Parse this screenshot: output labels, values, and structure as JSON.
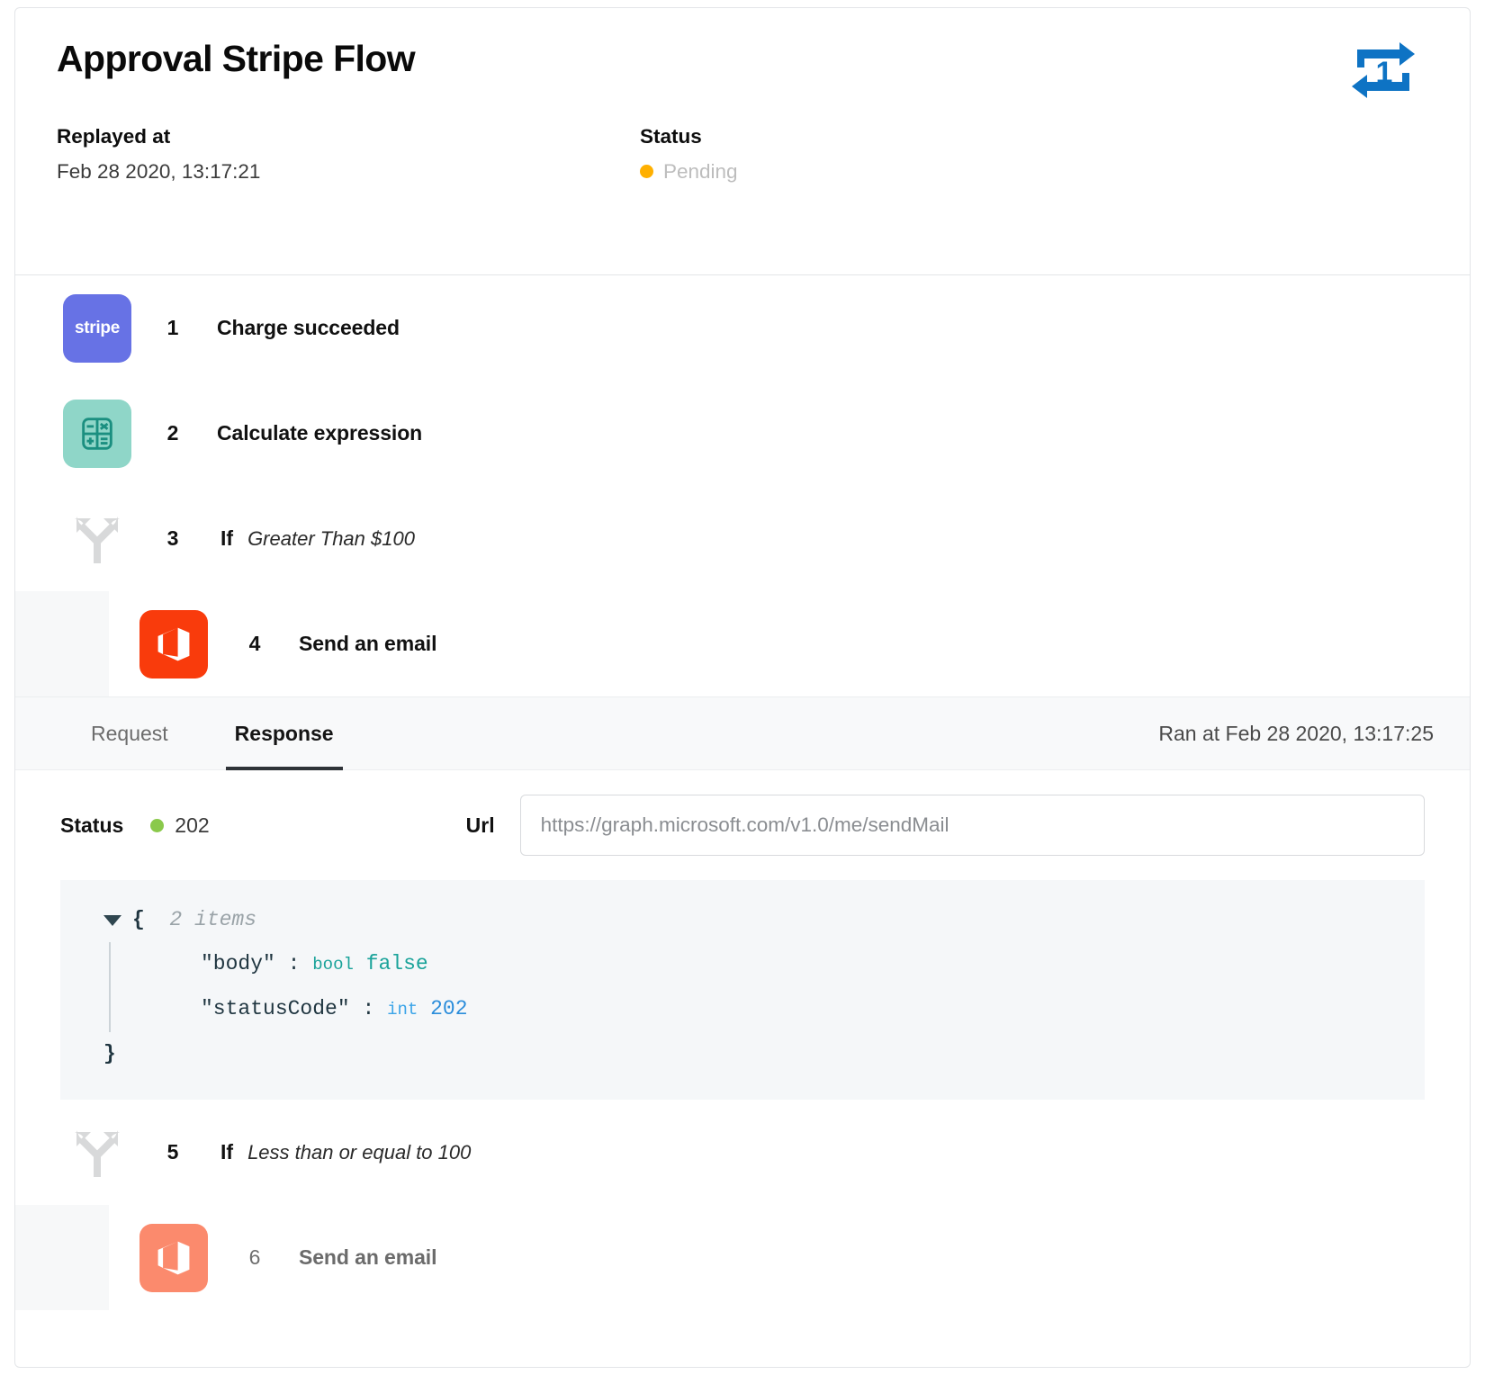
{
  "header": {
    "title": "Approval Stripe Flow",
    "replayed_label": "Replayed at",
    "replayed_value": "Feb 28 2020, 13:17:21",
    "status_label": "Status",
    "status_value": "Pending",
    "status_dot_color": "#ffb000",
    "replay_icon": "replay-once-icon",
    "replay_icon_color": "#0e73c4",
    "replay_icon_badge": "1"
  },
  "steps": [
    {
      "num": "1",
      "name": "Charge succeeded",
      "icon": "stripe-icon",
      "icon_label": "stripe",
      "icon_color": "#6772e5"
    },
    {
      "num": "2",
      "name": "Calculate expression",
      "icon": "calculator-icon",
      "icon_color": "#8fd6c8"
    },
    {
      "num": "3",
      "name": "If",
      "condition": "Greater Than $100",
      "icon": "branch-fork-icon",
      "icon_color": "#d8d9da"
    },
    {
      "num": "4",
      "name": "Send an email",
      "icon": "office365-icon",
      "icon_color": "#f93b0c"
    },
    {
      "num": "5",
      "name": "If",
      "condition": "Less than or equal to 100",
      "icon": "branch-fork-icon",
      "icon_color": "#d8d9da"
    },
    {
      "num": "6",
      "name": "Send an email",
      "icon": "office365-icon",
      "icon_color": "#fb8a6d"
    }
  ],
  "detail": {
    "tab_request": "Request",
    "tab_response": "Response",
    "ran_at": "Ran at Feb 28 2020, 13:17:25",
    "status_label": "Status",
    "status_code": "202",
    "status_dot_color": "#8ac94b",
    "url_label": "Url",
    "url_placeholder": "https://graph.microsoft.com/v1.0/me/sendMail",
    "url_value": ""
  },
  "json_viewer": {
    "open_brace": "{",
    "items_count": "2 items",
    "close_brace": "}",
    "rows": [
      {
        "key": "\"body\"",
        "colon": ":",
        "type": "bool",
        "value": "false"
      },
      {
        "key": "\"statusCode\"",
        "colon": ":",
        "type": "int",
        "value": "202"
      }
    ]
  }
}
